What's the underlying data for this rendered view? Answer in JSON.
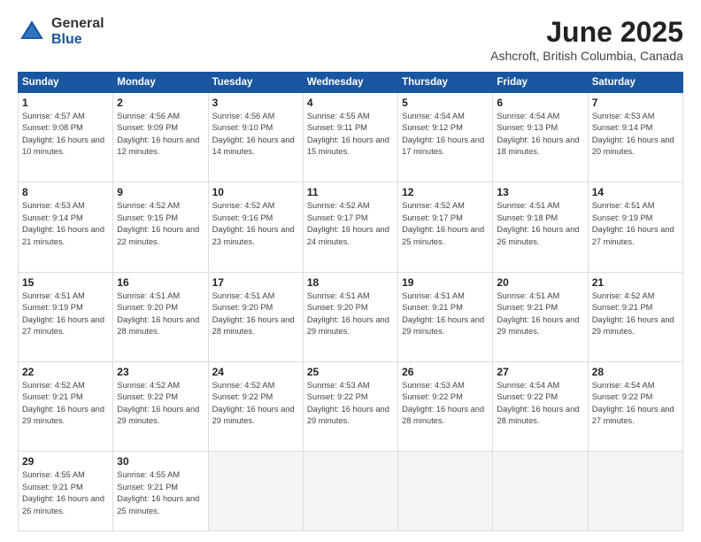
{
  "logo": {
    "general": "General",
    "blue": "Blue"
  },
  "title": "June 2025",
  "subtitle": "Ashcroft, British Columbia, Canada",
  "days_of_week": [
    "Sunday",
    "Monday",
    "Tuesday",
    "Wednesday",
    "Thursday",
    "Friday",
    "Saturday"
  ],
  "weeks": [
    [
      {
        "day": "1",
        "sunrise": "4:57 AM",
        "sunset": "9:08 PM",
        "daylight": "16 hours and 10 minutes."
      },
      {
        "day": "2",
        "sunrise": "4:56 AM",
        "sunset": "9:09 PM",
        "daylight": "16 hours and 12 minutes."
      },
      {
        "day": "3",
        "sunrise": "4:56 AM",
        "sunset": "9:10 PM",
        "daylight": "16 hours and 14 minutes."
      },
      {
        "day": "4",
        "sunrise": "4:55 AM",
        "sunset": "9:11 PM",
        "daylight": "16 hours and 15 minutes."
      },
      {
        "day": "5",
        "sunrise": "4:54 AM",
        "sunset": "9:12 PM",
        "daylight": "16 hours and 17 minutes."
      },
      {
        "day": "6",
        "sunrise": "4:54 AM",
        "sunset": "9:13 PM",
        "daylight": "16 hours and 18 minutes."
      },
      {
        "day": "7",
        "sunrise": "4:53 AM",
        "sunset": "9:14 PM",
        "daylight": "16 hours and 20 minutes."
      }
    ],
    [
      {
        "day": "8",
        "sunrise": "4:53 AM",
        "sunset": "9:14 PM",
        "daylight": "16 hours and 21 minutes."
      },
      {
        "day": "9",
        "sunrise": "4:52 AM",
        "sunset": "9:15 PM",
        "daylight": "16 hours and 22 minutes."
      },
      {
        "day": "10",
        "sunrise": "4:52 AM",
        "sunset": "9:16 PM",
        "daylight": "16 hours and 23 minutes."
      },
      {
        "day": "11",
        "sunrise": "4:52 AM",
        "sunset": "9:17 PM",
        "daylight": "16 hours and 24 minutes."
      },
      {
        "day": "12",
        "sunrise": "4:52 AM",
        "sunset": "9:17 PM",
        "daylight": "16 hours and 25 minutes."
      },
      {
        "day": "13",
        "sunrise": "4:51 AM",
        "sunset": "9:18 PM",
        "daylight": "16 hours and 26 minutes."
      },
      {
        "day": "14",
        "sunrise": "4:51 AM",
        "sunset": "9:19 PM",
        "daylight": "16 hours and 27 minutes."
      }
    ],
    [
      {
        "day": "15",
        "sunrise": "4:51 AM",
        "sunset": "9:19 PM",
        "daylight": "16 hours and 27 minutes."
      },
      {
        "day": "16",
        "sunrise": "4:51 AM",
        "sunset": "9:20 PM",
        "daylight": "16 hours and 28 minutes."
      },
      {
        "day": "17",
        "sunrise": "4:51 AM",
        "sunset": "9:20 PM",
        "daylight": "16 hours and 28 minutes."
      },
      {
        "day": "18",
        "sunrise": "4:51 AM",
        "sunset": "9:20 PM",
        "daylight": "16 hours and 29 minutes."
      },
      {
        "day": "19",
        "sunrise": "4:51 AM",
        "sunset": "9:21 PM",
        "daylight": "16 hours and 29 minutes."
      },
      {
        "day": "20",
        "sunrise": "4:51 AM",
        "sunset": "9:21 PM",
        "daylight": "16 hours and 29 minutes."
      },
      {
        "day": "21",
        "sunrise": "4:52 AM",
        "sunset": "9:21 PM",
        "daylight": "16 hours and 29 minutes."
      }
    ],
    [
      {
        "day": "22",
        "sunrise": "4:52 AM",
        "sunset": "9:21 PM",
        "daylight": "16 hours and 29 minutes."
      },
      {
        "day": "23",
        "sunrise": "4:52 AM",
        "sunset": "9:22 PM",
        "daylight": "16 hours and 29 minutes."
      },
      {
        "day": "24",
        "sunrise": "4:52 AM",
        "sunset": "9:22 PM",
        "daylight": "16 hours and 29 minutes."
      },
      {
        "day": "25",
        "sunrise": "4:53 AM",
        "sunset": "9:22 PM",
        "daylight": "16 hours and 29 minutes."
      },
      {
        "day": "26",
        "sunrise": "4:53 AM",
        "sunset": "9:22 PM",
        "daylight": "16 hours and 28 minutes."
      },
      {
        "day": "27",
        "sunrise": "4:54 AM",
        "sunset": "9:22 PM",
        "daylight": "16 hours and 28 minutes."
      },
      {
        "day": "28",
        "sunrise": "4:54 AM",
        "sunset": "9:22 PM",
        "daylight": "16 hours and 27 minutes."
      }
    ],
    [
      {
        "day": "29",
        "sunrise": "4:55 AM",
        "sunset": "9:21 PM",
        "daylight": "16 hours and 26 minutes."
      },
      {
        "day": "30",
        "sunrise": "4:55 AM",
        "sunset": "9:21 PM",
        "daylight": "16 hours and 25 minutes."
      },
      null,
      null,
      null,
      null,
      null
    ]
  ]
}
